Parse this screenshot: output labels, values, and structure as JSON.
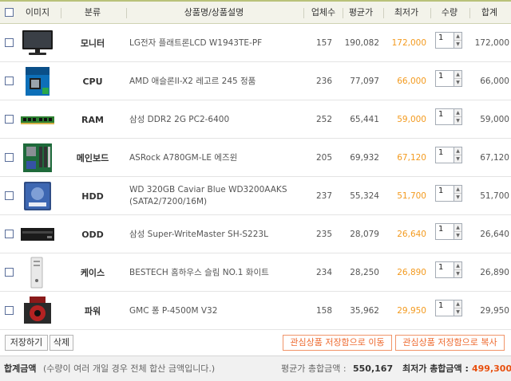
{
  "header": {
    "image": "이미지",
    "category": "분류",
    "product": "상품명/상품설명",
    "stores": "업체수",
    "avg_price": "평균가",
    "min_price": "최저가",
    "quantity": "수량",
    "total": "합계"
  },
  "rows": [
    {
      "category": "모니터",
      "name": "LG전자 플래트론LCD W1943TE-PF",
      "name2": "",
      "stores": "157",
      "avg": "190,082",
      "min": "172,000",
      "qty": "1",
      "total": "172,000"
    },
    {
      "category": "CPU",
      "name": "AMD 애슬론II-X2 레고르 245 정품",
      "name2": "",
      "stores": "236",
      "avg": "77,097",
      "min": "66,000",
      "qty": "1",
      "total": "66,000"
    },
    {
      "category": "RAM",
      "name": "삼성 DDR2 2G PC2-6400",
      "name2": "",
      "stores": "252",
      "avg": "65,441",
      "min": "59,000",
      "qty": "1",
      "total": "59,000"
    },
    {
      "category": "메인보드",
      "name": "ASRock A780GM-LE 에즈윈",
      "name2": "",
      "stores": "205",
      "avg": "69,932",
      "min": "67,120",
      "qty": "1",
      "total": "67,120"
    },
    {
      "category": "HDD",
      "name": "WD 320GB Caviar Blue WD3200AAKS",
      "name2": "(SATA2/7200/16M)",
      "stores": "237",
      "avg": "55,324",
      "min": "51,700",
      "qty": "1",
      "total": "51,700"
    },
    {
      "category": "ODD",
      "name": "삼성 Super-WriteMaster SH-S223L",
      "name2": "",
      "stores": "235",
      "avg": "28,079",
      "min": "26,640",
      "qty": "1",
      "total": "26,640"
    },
    {
      "category": "케이스",
      "name": "BESTECH 홈하우스 슬림 NO.1 화이트",
      "name2": "",
      "stores": "234",
      "avg": "28,250",
      "min": "26,890",
      "qty": "1",
      "total": "26,890"
    },
    {
      "category": "파워",
      "name": "GMC 퐁 P-4500M V32",
      "name2": "",
      "stores": "158",
      "avg": "35,962",
      "min": "29,950",
      "qty": "1",
      "total": "29,950"
    }
  ],
  "buttons": {
    "save": "저장하기",
    "delete": "삭제",
    "move": "관심상품 저장함으로 이동",
    "copy": "관심상품 저장함으로 복사"
  },
  "footer": {
    "label": "합계금액",
    "note": "(수량이 여러 개일 경우 전체 합산 금액입니다.)",
    "avg_label": "평균가 총합금액 :",
    "avg_value": "550,167",
    "min_label": "최저가 총합금액 :",
    "min_value": "499,300"
  },
  "colors": {
    "header_bg": "#f3f3ea",
    "accent_low_price": "#f39a1e",
    "min_total": "#e8500f",
    "orange_button": "#ee6a2f"
  }
}
